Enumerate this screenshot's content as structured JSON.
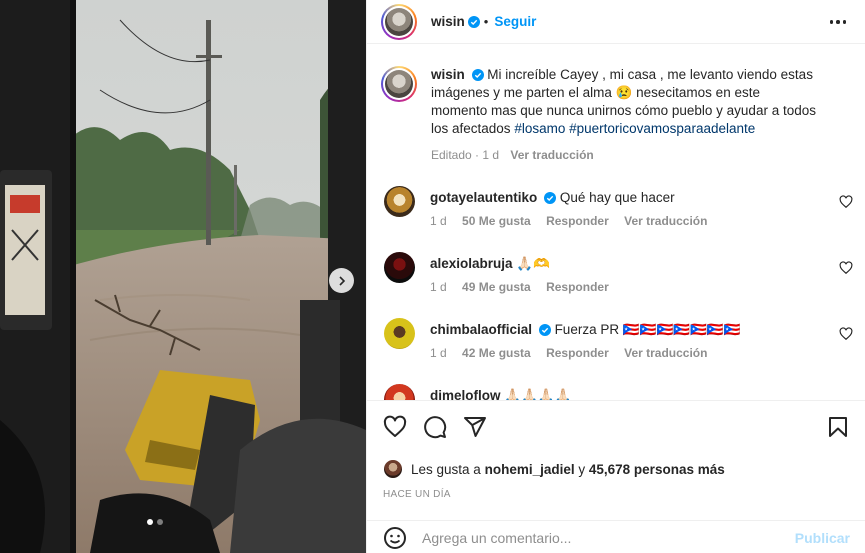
{
  "post": {
    "author": "wisin",
    "follow_label": "Seguir",
    "separator": "•",
    "caption": {
      "author": "wisin",
      "text": "Mi increíble Cayey , mi casa , me levanto viendo estas imágenes y me parten el alma 😢 nesecitamos en este momento mas que nunca unirnos cómo pueblo y ayudar a todos los afectados",
      "hashtags": [
        "#losamo",
        "#puertoricovamosparaadelante"
      ],
      "edited_time": "Editado · 1 d",
      "see_translation": "Ver traducción"
    }
  },
  "comments": [
    {
      "user": "gotayelautentiko",
      "verified": true,
      "text": "Qué hay que hacer",
      "time": "1 d",
      "likes": "50 Me gusta",
      "reply": "Responder",
      "translate": "Ver traducción"
    },
    {
      "user": "alexiolabruja",
      "verified": false,
      "text": "🙏🏻🫶",
      "time": "1 d",
      "likes": "49 Me gusta",
      "reply": "Responder",
      "translate": ""
    },
    {
      "user": "chimbalaofficial",
      "verified": true,
      "text": "Fuerza PR 🇵🇷🇵🇷🇵🇷🇵🇷🇵🇷🇵🇷🇵🇷",
      "time": "1 d",
      "likes": "42 Me gusta",
      "reply": "Responder",
      "translate": "Ver traducción"
    },
    {
      "user": "dimeloflow",
      "verified": false,
      "text": "🙏🏻🙏🏻🙏🏻🙏🏻",
      "time": "",
      "likes": "",
      "reply": "",
      "translate": ""
    }
  ],
  "likes_summary": {
    "prefix": "Les gusta a",
    "user": "nohemi_jadiel",
    "conjunction": "y",
    "others": "45,678 personas más"
  },
  "date_label": "HACE UN DÍA",
  "add_comment": {
    "placeholder": "Agrega un comentario...",
    "publish_label": "Publicar"
  },
  "carousel": {
    "current_index": 1,
    "total": 2
  },
  "icons": {
    "verified": "verified-badge-icon",
    "like": "heart-icon",
    "comment": "comment-icon",
    "share": "paper-plane-icon",
    "save": "bookmark-icon",
    "emoji": "emoji-icon",
    "more": "more-horizontal-icon",
    "next": "chevron-right-icon"
  },
  "colors": {
    "accent": "#0095f6",
    "hashtag": "#00376b",
    "muted": "#8e8e8e",
    "publish_disabled": "#b2dffc",
    "verified": "#0095f6"
  }
}
